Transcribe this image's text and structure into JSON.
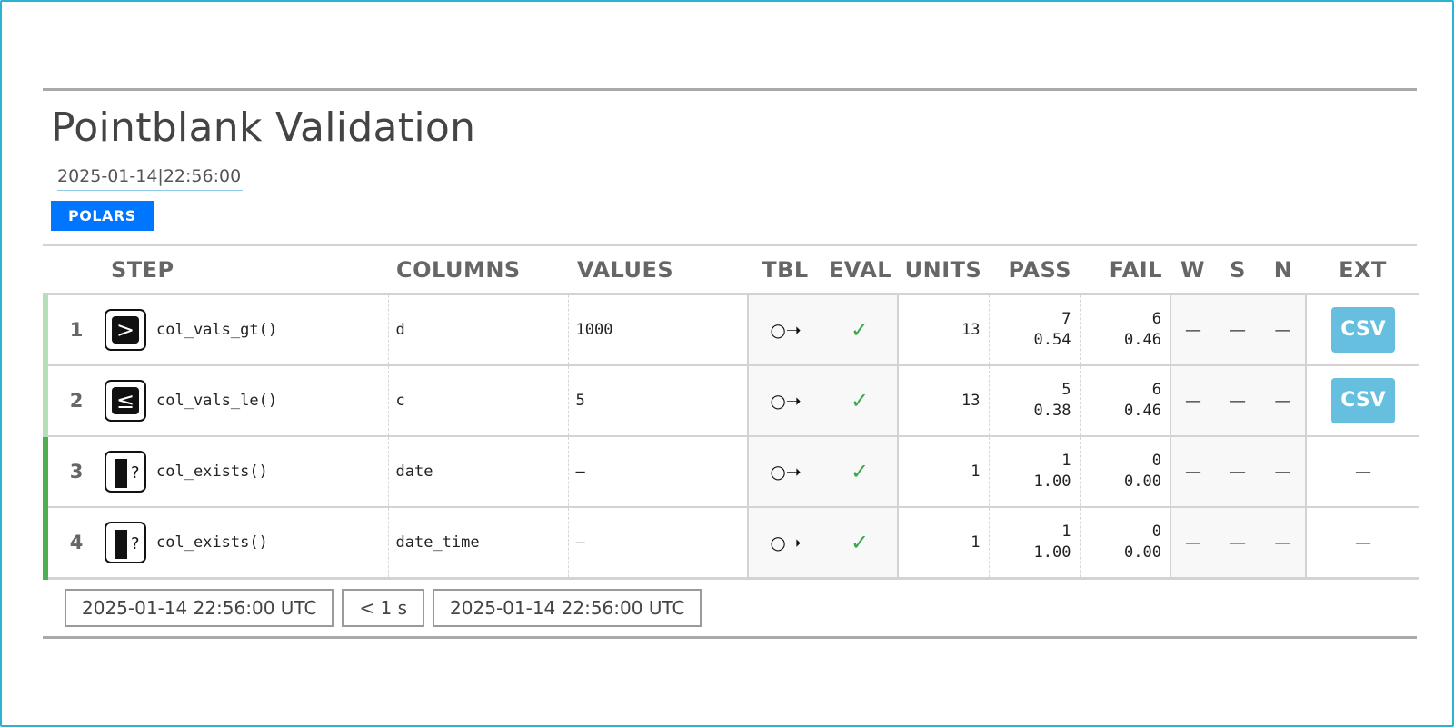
{
  "report": {
    "title": "Pointblank Validation",
    "timestamp": "2025-01-14|22:56:00",
    "engine_badge": "POLARS"
  },
  "colors": {
    "frame_border": "#2bb3d4",
    "badge_bg": "#0075ff",
    "csv_bg": "#67bfe0",
    "pass_check": "#3aa84a",
    "row_bar_light": "#b7dfb7",
    "row_bar_dark": "#4caf50"
  },
  "headers": {
    "step": "STEP",
    "columns": "COLUMNS",
    "values": "VALUES",
    "tbl": "TBL",
    "eval": "EVAL",
    "units": "UNITS",
    "pass": "PASS",
    "fail": "FAIL",
    "w": "W",
    "s": "S",
    "n": "N",
    "ext": "EXT"
  },
  "rows": [
    {
      "num": "1",
      "icon": "greater-than-icon",
      "icon_glyph": ">",
      "step": "col_vals_gt()",
      "column": "d",
      "value": "1000",
      "tbl": "○➝",
      "eval": "✓",
      "units": "13",
      "pass_n": "7",
      "pass_f": "0.54",
      "fail_n": "6",
      "fail_f": "0.46",
      "w": "—",
      "s": "—",
      "n": "—",
      "ext": "CSV"
    },
    {
      "num": "2",
      "icon": "less-equal-icon",
      "icon_glyph": "≤",
      "step": "col_vals_le()",
      "column": "c",
      "value": "5",
      "tbl": "○➝",
      "eval": "✓",
      "units": "13",
      "pass_n": "5",
      "pass_f": "0.38",
      "fail_n": "6",
      "fail_f": "0.46",
      "w": "—",
      "s": "—",
      "n": "—",
      "ext": "CSV"
    },
    {
      "num": "3",
      "icon": "column-exists-icon",
      "icon_glyph": "?",
      "step": "col_exists()",
      "column": "date",
      "value": "—",
      "tbl": "○➝",
      "eval": "✓",
      "units": "1",
      "pass_n": "1",
      "pass_f": "1.00",
      "fail_n": "0",
      "fail_f": "0.00",
      "w": "—",
      "s": "—",
      "n": "—",
      "ext": "—"
    },
    {
      "num": "4",
      "icon": "column-exists-icon",
      "icon_glyph": "?",
      "step": "col_exists()",
      "column": "date_time",
      "value": "—",
      "tbl": "○➝",
      "eval": "✓",
      "units": "1",
      "pass_n": "1",
      "pass_f": "1.00",
      "fail_n": "0",
      "fail_f": "0.00",
      "w": "—",
      "s": "—",
      "n": "—",
      "ext": "—"
    }
  ],
  "footer": {
    "start_time": "2025-01-14 22:56:00 UTC",
    "duration": "< 1 s",
    "end_time": "2025-01-14 22:56:00 UTC"
  }
}
